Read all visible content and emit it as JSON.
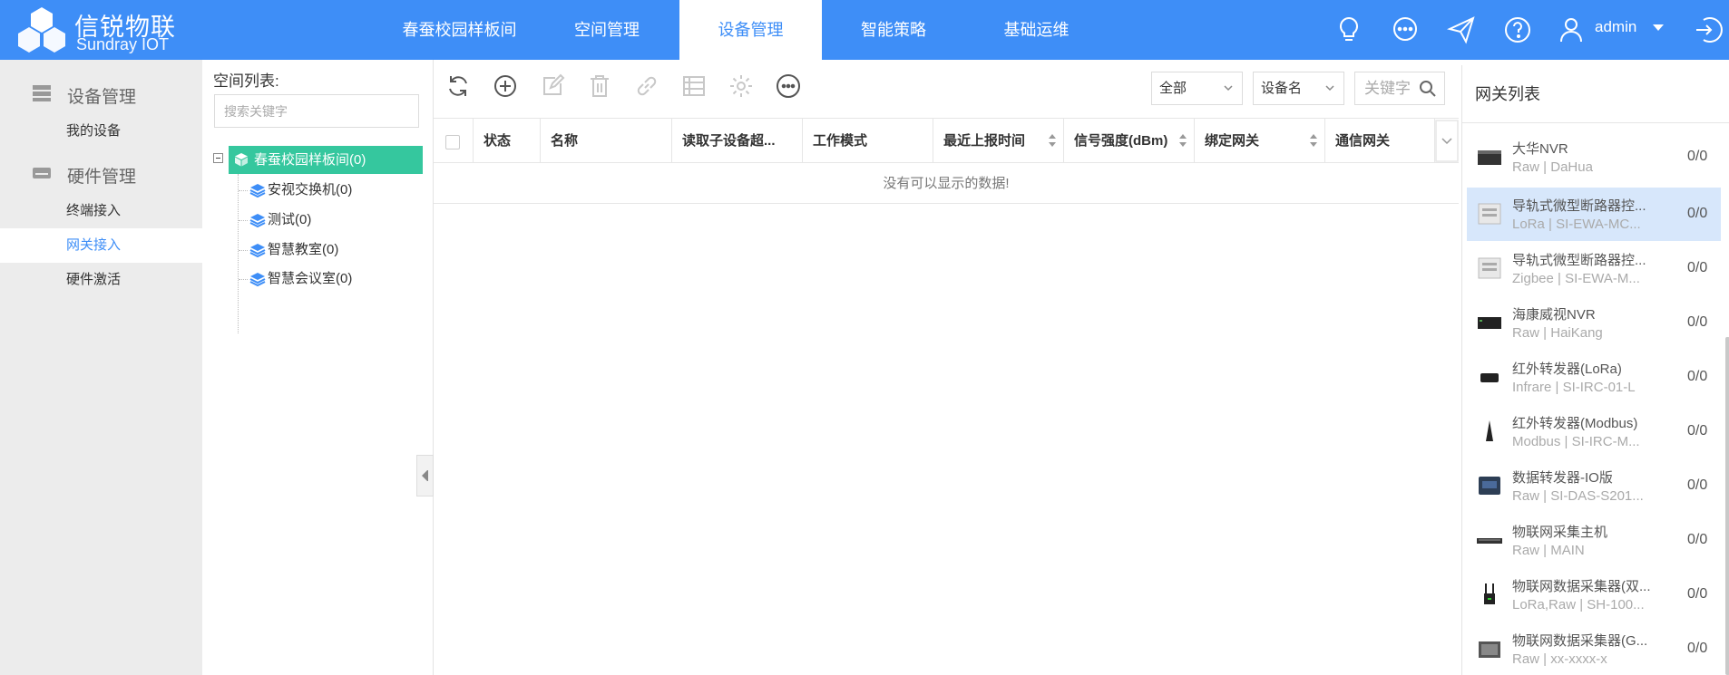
{
  "brand": {
    "title": "信锐物联",
    "subtitle": "Sundray IOT"
  },
  "nav": [
    {
      "label": "春蚕校园样板间"
    },
    {
      "label": "空间管理"
    },
    {
      "label": "设备管理"
    },
    {
      "label": "智能策略"
    },
    {
      "label": "基础运维"
    }
  ],
  "header": {
    "user": "admin",
    "icons": [
      "bulb-icon",
      "chat-icon",
      "send-icon",
      "help-icon",
      "user-icon",
      "logout-icon"
    ]
  },
  "sidebar": {
    "groups": [
      {
        "label": "设备管理",
        "icon": "server-icon",
        "items": [
          {
            "label": "我的设备"
          }
        ]
      },
      {
        "label": "硬件管理",
        "icon": "hardware-icon",
        "items": [
          {
            "label": "终端接入"
          },
          {
            "label": "网关接入"
          },
          {
            "label": "硬件激活"
          }
        ]
      }
    ]
  },
  "space": {
    "title": "空间列表:",
    "search_placeholder": "搜索关键字",
    "root": "春蚕校园样板间(0)",
    "children": [
      "安视交换机(0)",
      "测试(0)",
      "智慧教室(0)",
      "智慧会议室(0)"
    ]
  },
  "toolbar": {
    "filter_scope": "全部",
    "filter_field": "设备名",
    "keyword_placeholder": "关键字"
  },
  "grid": {
    "columns": [
      "状态",
      "名称",
      "读取子设备超...",
      "工作模式",
      "最近上报时间",
      "信号强度(dBm)",
      "绑定网关",
      "通信网关"
    ],
    "empty_text": "没有可以显示的数据!"
  },
  "gateways": {
    "title": "网关列表",
    "items": [
      {
        "name": "大华NVR",
        "sub": "Raw | DaHua",
        "count": "0/0"
      },
      {
        "name": "导轨式微型断路器控...",
        "sub": "LoRa | SI-EWA-MC...",
        "count": "0/0"
      },
      {
        "name": "导轨式微型断路器控...",
        "sub": "Zigbee | SI-EWA-M...",
        "count": "0/0"
      },
      {
        "name": "海康威视NVR",
        "sub": "Raw | HaiKang",
        "count": "0/0"
      },
      {
        "name": "红外转发器(LoRa)",
        "sub": "Infrare | SI-IRC-01-L",
        "count": "0/0"
      },
      {
        "name": "红外转发器(Modbus)",
        "sub": "Modbus | SI-IRC-M...",
        "count": "0/0"
      },
      {
        "name": "数据转发器-IO版",
        "sub": "Raw | SI-DAS-S201...",
        "count": "0/0"
      },
      {
        "name": "物联网采集主机",
        "sub": "Raw | MAIN",
        "count": "0/0"
      },
      {
        "name": "物联网数据采集器(双...",
        "sub": "LoRa,Raw | SH-100...",
        "count": "0/0"
      },
      {
        "name": "物联网数据采集器(G...",
        "sub": "Raw | xx-xxxx-x",
        "count": "0/0"
      }
    ]
  },
  "colors": {
    "primary": "#3e8ef7",
    "tree_active": "#35c79e",
    "selected_row": "#d7e7fb"
  }
}
